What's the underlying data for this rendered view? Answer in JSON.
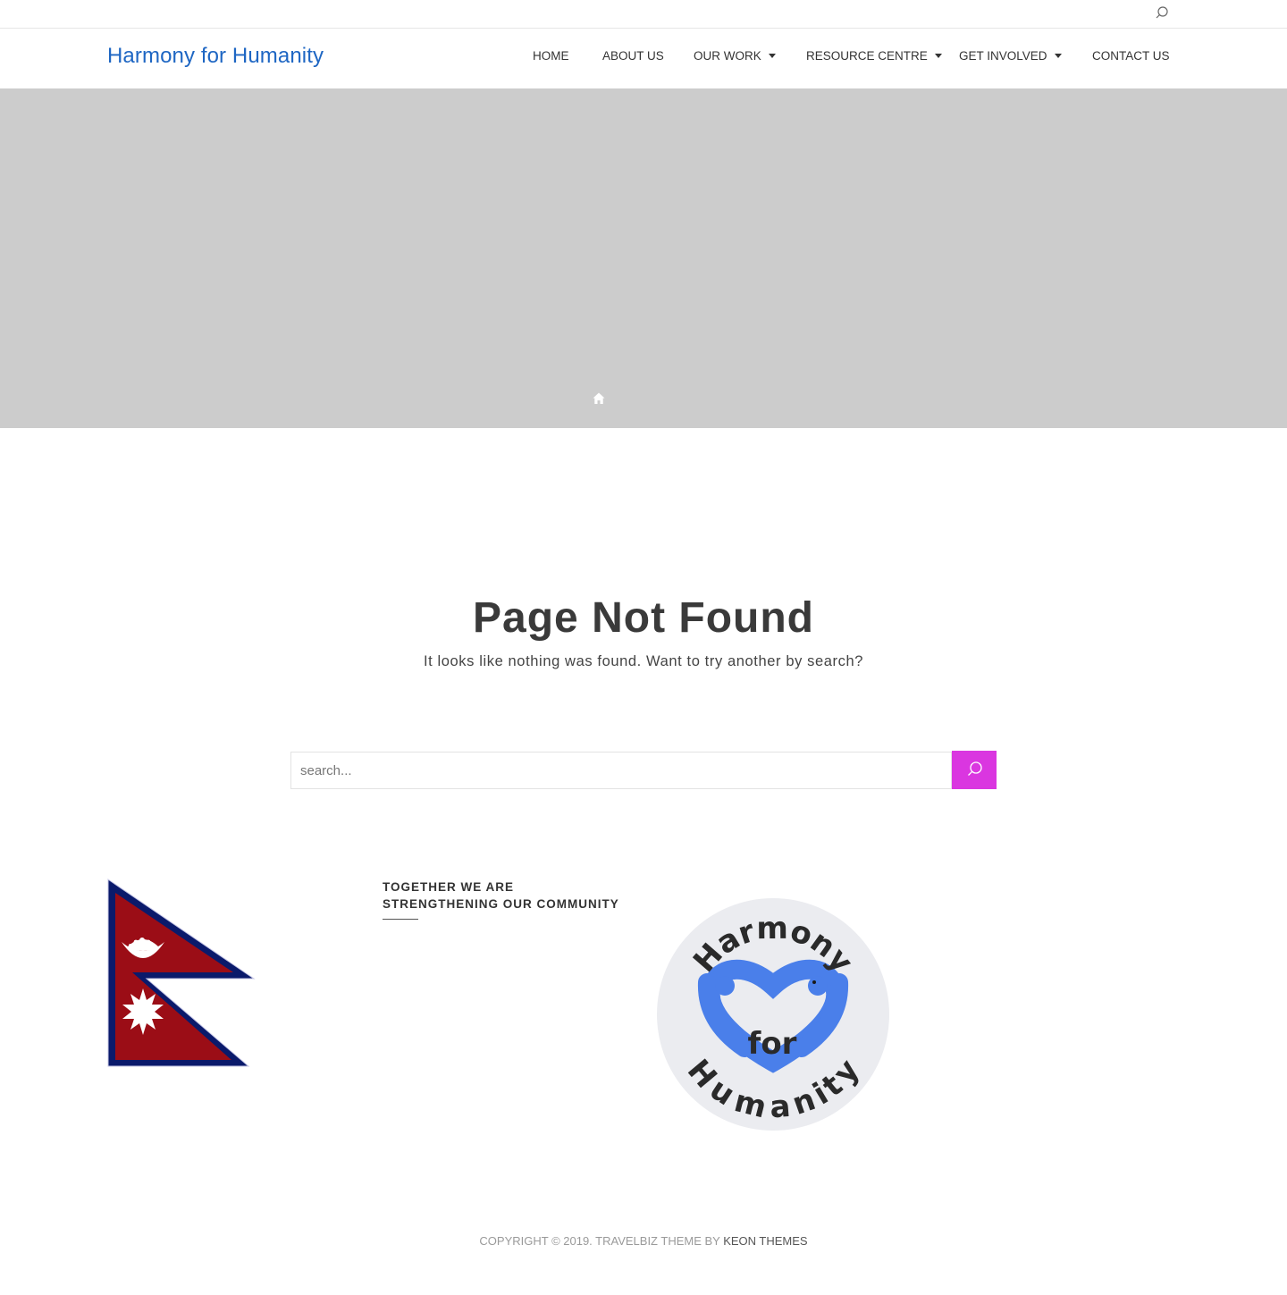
{
  "header": {
    "site_title": "Harmony for Humanity",
    "nav": [
      {
        "label": "HOME"
      },
      {
        "label": "ABOUT US"
      },
      {
        "label": "OUR WORK"
      },
      {
        "label": "RESOURCE CENTRE"
      },
      {
        "label": "GET INVOLVED"
      },
      {
        "label": "CONTACT US"
      }
    ]
  },
  "icons": {
    "top_search": "search-icon",
    "banner_home": "home-icon",
    "search_submit": "search-icon"
  },
  "main": {
    "title": "Page Not Found",
    "subtitle": "It looks like nothing was found. Want to try another by search?",
    "search": {
      "placeholder": "search...",
      "value": ""
    }
  },
  "widgets": {
    "community_title": "TOGETHER WE ARE STRENGTHENING OUR COMMUNITY",
    "logo": {
      "top_word": "Harmony",
      "middle_word": "for",
      "bottom_word": "Humanity"
    }
  },
  "footer": {
    "copyright": "COPYRIGHT © 2019. TRAVELBIZ THEME BY ",
    "credit_link": "KEON THEMES"
  },
  "colors": {
    "brand_blue": "#1e66c3",
    "search_button": "#da36e0",
    "banner_gray": "#cccccc",
    "flag_red": "#9b0d16",
    "flag_border": "#0a1a6b",
    "logo_blue": "#4a7fea"
  }
}
